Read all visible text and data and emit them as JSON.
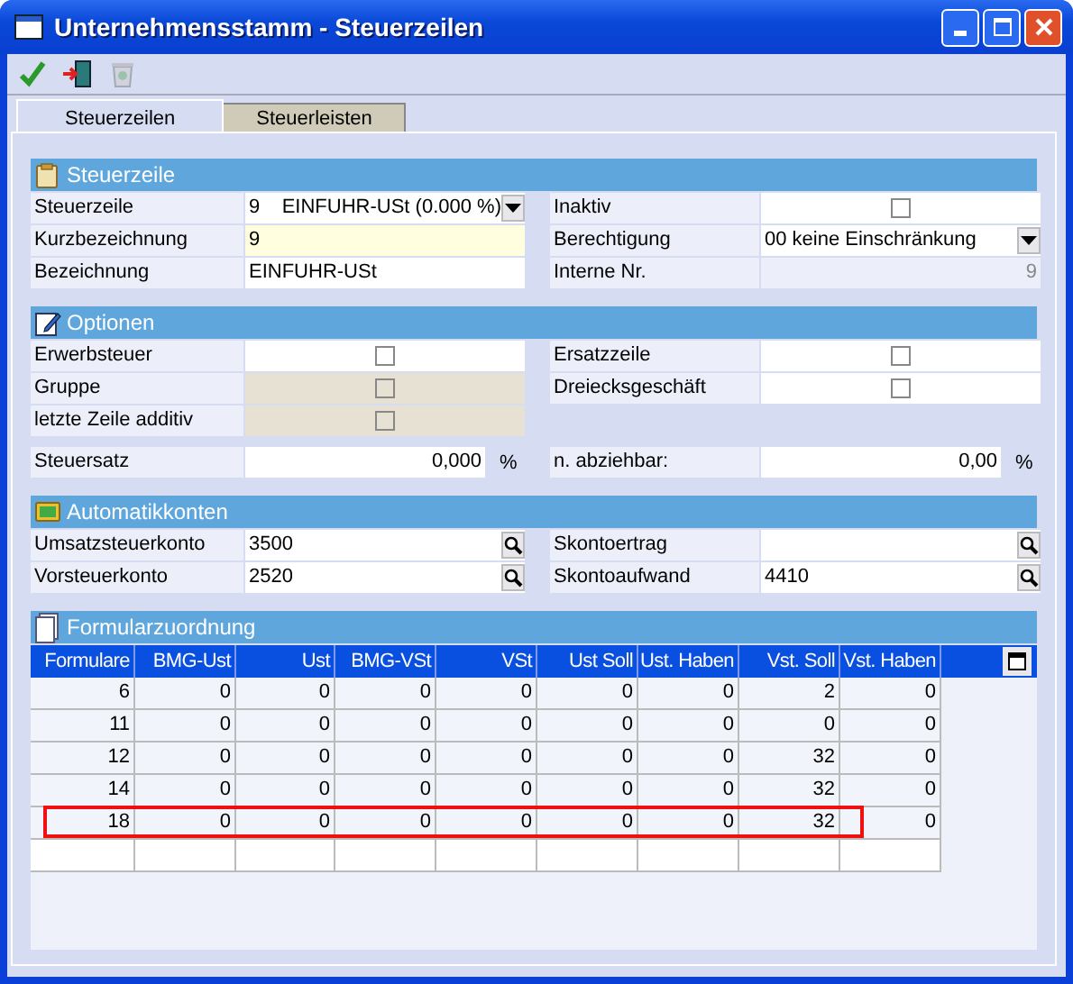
{
  "window": {
    "title": "Unternehmensstamm - Steuerzeilen"
  },
  "toolbar": [
    {
      "kind": "check",
      "disabled": false
    },
    {
      "kind": "exit",
      "disabled": false
    },
    {
      "kind": "bin",
      "disabled": true
    }
  ],
  "tabs": [
    {
      "label": "Steuerzeilen",
      "selected": true
    },
    {
      "label": "Steuerleisten",
      "selected": false
    }
  ],
  "sections": [
    {
      "title": "Steuerzeile",
      "rows": [
        [
          {
            "label": "Steuerzeile",
            "kind": "select",
            "value": "9    EINFUHR-USt (0.000 %)"
          },
          {
            "label": "Inaktiv",
            "kind": "checkbox",
            "checked": false,
            "disabled": false
          }
        ],
        [
          {
            "label": "Kurzbezeichnung",
            "kind": "text",
            "value": "9",
            "required": true
          },
          {
            "label": "Berechtigung",
            "kind": "select",
            "value": "00 keine Einschränkung"
          }
        ],
        [
          {
            "label": "Bezeichnung",
            "kind": "text",
            "value": "EINFUHR-USt",
            "required": false
          },
          {
            "label": "Interne Nr.",
            "kind": "readonly",
            "value": "9"
          }
        ]
      ]
    },
    {
      "title": "Optionen",
      "rows": [
        [
          {
            "label": "Erwerbsteuer",
            "kind": "checkbox",
            "checked": false,
            "disabled": false
          },
          {
            "label": "Ersatzzeile",
            "kind": "checkbox",
            "checked": false,
            "disabled": false
          }
        ],
        [
          {
            "label": "Gruppe",
            "kind": "checkbox",
            "checked": false,
            "disabled": true
          },
          {
            "label": "Dreiecksgeschäft",
            "kind": "checkbox",
            "checked": false,
            "disabled": false
          }
        ],
        [
          {
            "label": "letzte Zeile additiv",
            "kind": "checkbox",
            "checked": false,
            "disabled": true
          }
        ]
      ],
      "rate_rows": [
        [
          {
            "label": "Steuersatz",
            "kind": "number",
            "value": "0,000",
            "unit": "%"
          },
          {
            "label": "n. abziehbar:",
            "kind": "number",
            "value": "0,00",
            "unit": "%"
          }
        ]
      ]
    },
    {
      "title": "Automatikkonten",
      "rows": [
        [
          {
            "label": "Umsatzsteuerkonto",
            "kind": "lookup",
            "value": "3500"
          },
          {
            "label": "Skontoertrag",
            "kind": "lookup"
          }
        ],
        [
          {
            "label": "Vorsteuerkonto",
            "kind": "lookup",
            "value": "2520"
          },
          {
            "label": "Skontoaufwand",
            "kind": "lookup",
            "value": "4410"
          }
        ]
      ]
    }
  ],
  "formular": {
    "title": "Formularzuordnung",
    "table": {
      "columns": [
        "Formulare",
        "BMG-Ust",
        "Ust",
        "BMG-VSt",
        "VSt",
        "Ust Soll",
        "Ust. Haben",
        "Vst. Soll",
        "Vst. Haben"
      ],
      "rows": [
        {
          "cells": [
            "6",
            "0",
            "0",
            "0",
            "0",
            "0",
            "0",
            "2",
            "0"
          ],
          "highlighted": false
        },
        {
          "cells": [
            "11",
            "0",
            "0",
            "0",
            "0",
            "0",
            "0",
            "0",
            "0"
          ],
          "highlighted": false
        },
        {
          "cells": [
            "12",
            "0",
            "0",
            "0",
            "0",
            "0",
            "0",
            "32",
            "0"
          ],
          "highlighted": false
        },
        {
          "cells": [
            "14",
            "0",
            "0",
            "0",
            "0",
            "0",
            "0",
            "32",
            "0"
          ],
          "highlighted": false
        },
        {
          "cells": [
            "18",
            "0",
            "0",
            "0",
            "0",
            "0",
            "0",
            "32",
            "0"
          ],
          "highlighted": true
        }
      ]
    }
  }
}
